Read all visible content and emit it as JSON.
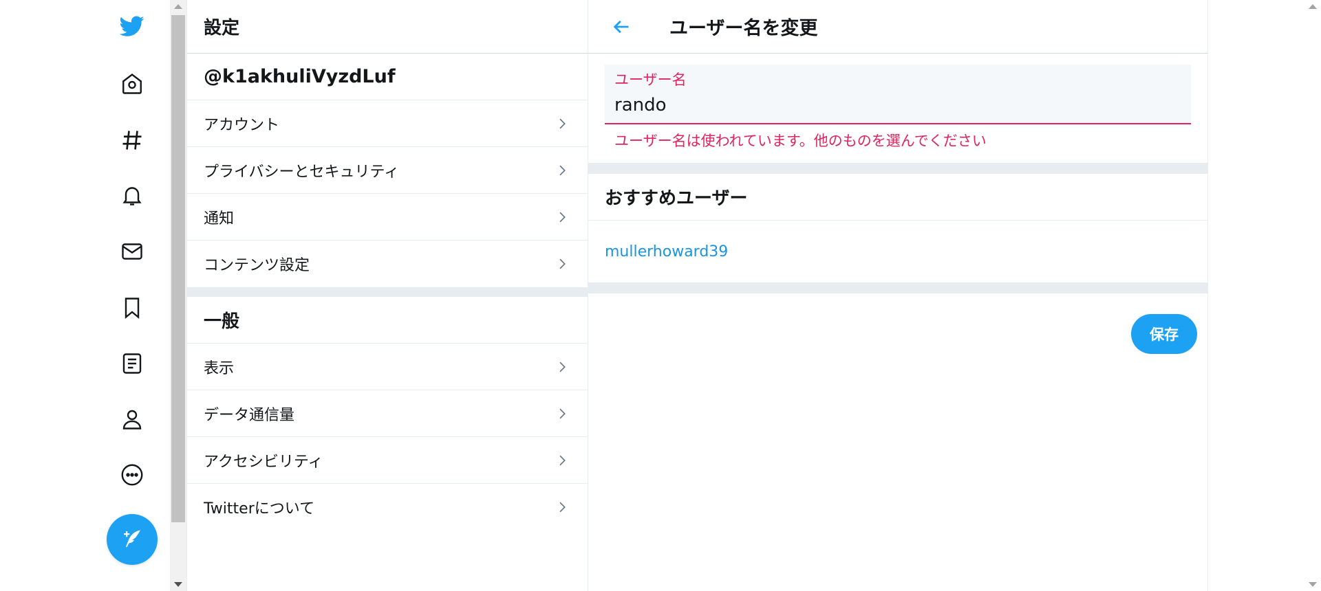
{
  "nav": {
    "icons": [
      "twitter-logo-icon",
      "home-icon",
      "explore-hashtag-icon",
      "notifications-bell-icon",
      "messages-mail-icon",
      "bookmarks-icon",
      "lists-icon",
      "profile-icon",
      "more-icon",
      "compose-tweet-icon"
    ],
    "accent_color": "#1da1f2"
  },
  "settings": {
    "title": "設定",
    "handle": "@k1akhuliVyzdLuf",
    "account_items": [
      {
        "label": "アカウント"
      },
      {
        "label": "プライバシーとセキュリティ"
      },
      {
        "label": "通知"
      },
      {
        "label": "コンテンツ設定"
      }
    ],
    "general_title": "一般",
    "general_items": [
      {
        "label": "表示"
      },
      {
        "label": "データ通信量"
      },
      {
        "label": "アクセシビリティ"
      },
      {
        "label": "Twitterについて"
      }
    ]
  },
  "main": {
    "title": "ユーザー名を変更",
    "field_label": "ユーザー名",
    "field_value": "rando",
    "error_text": "ユーザー名は使われています。他のものを選んでください",
    "error_color": "#e0245e",
    "suggest_title": "おすすめユーザー",
    "suggestions": [
      "mullerhoward39"
    ],
    "save_label": "保存"
  }
}
